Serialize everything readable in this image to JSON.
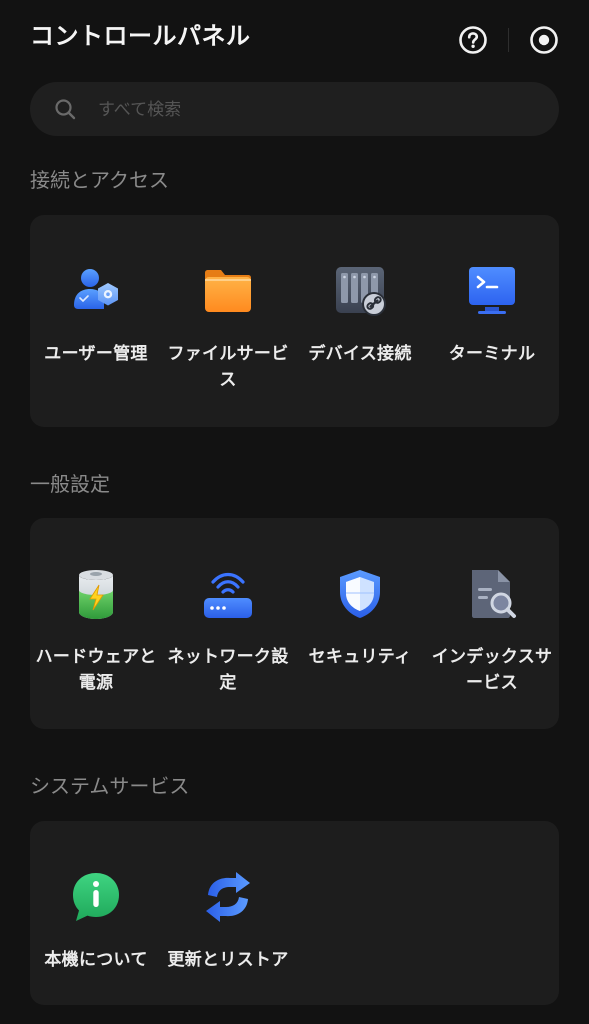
{
  "header": {
    "title": "コントロールパネル",
    "help_icon": "help-circle-icon",
    "target_icon": "target-icon"
  },
  "search": {
    "placeholder": "すべて検索"
  },
  "sections": [
    {
      "title": "接続とアクセス",
      "items": [
        {
          "label": "ユーザー管理",
          "icon": "users-icon"
        },
        {
          "label": "ファイルサービス",
          "icon": "folder-icon"
        },
        {
          "label": "デバイス接続",
          "icon": "nas-link-icon"
        },
        {
          "label": "ターミナル",
          "icon": "terminal-icon"
        }
      ]
    },
    {
      "title": "一般設定",
      "items": [
        {
          "label": "ハードウェアと電源",
          "icon": "battery-icon"
        },
        {
          "label": "ネットワーク設定",
          "icon": "router-icon"
        },
        {
          "label": "セキュリティ",
          "icon": "shield-icon"
        },
        {
          "label": "インデックスサービス",
          "icon": "document-search-icon"
        }
      ]
    },
    {
      "title": "システムサービス",
      "items": [
        {
          "label": "本機について",
          "icon": "info-icon"
        },
        {
          "label": "更新とリストア",
          "icon": "refresh-icon"
        }
      ]
    }
  ],
  "colors": {
    "background": "#121212",
    "card": "#1d1d1d",
    "accent_blue": "#2f6bff",
    "accent_orange": "#ff9a2e",
    "accent_green": "#2fbf71"
  }
}
